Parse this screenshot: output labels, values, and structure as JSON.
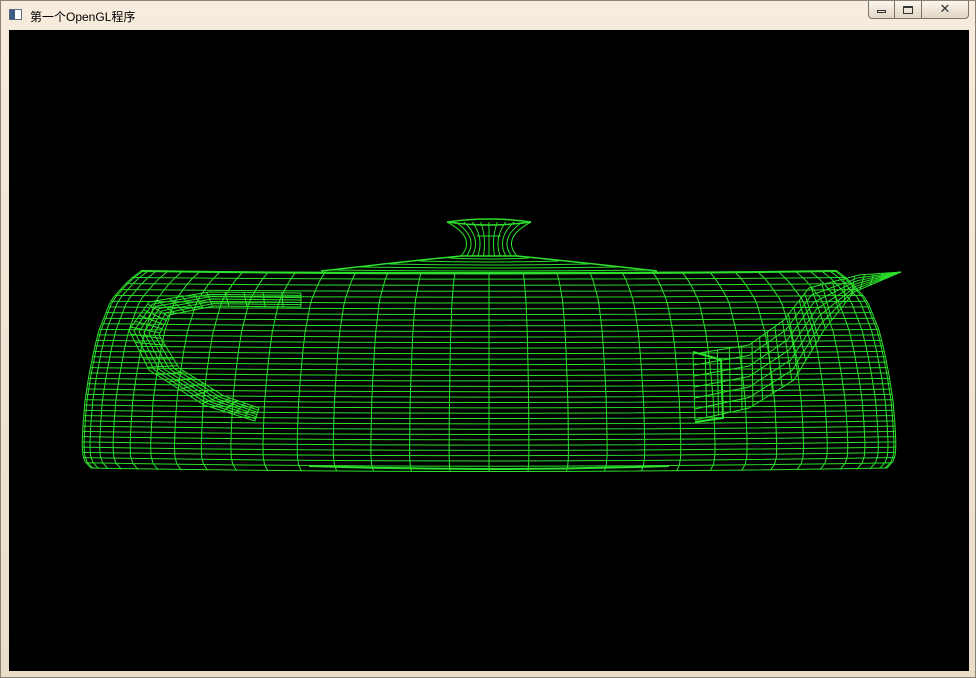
{
  "window": {
    "title": "第一个OpenGL程序",
    "icon": "window-app-icon",
    "buttons": {
      "minimize_icon": "minimize-icon",
      "maximize_icon": "maximize-icon",
      "close_icon": "close-icon"
    }
  },
  "canvas": {
    "background_color": "#000000",
    "wireframe_color": "#2de02d",
    "object": "teapot-wireframe"
  }
}
